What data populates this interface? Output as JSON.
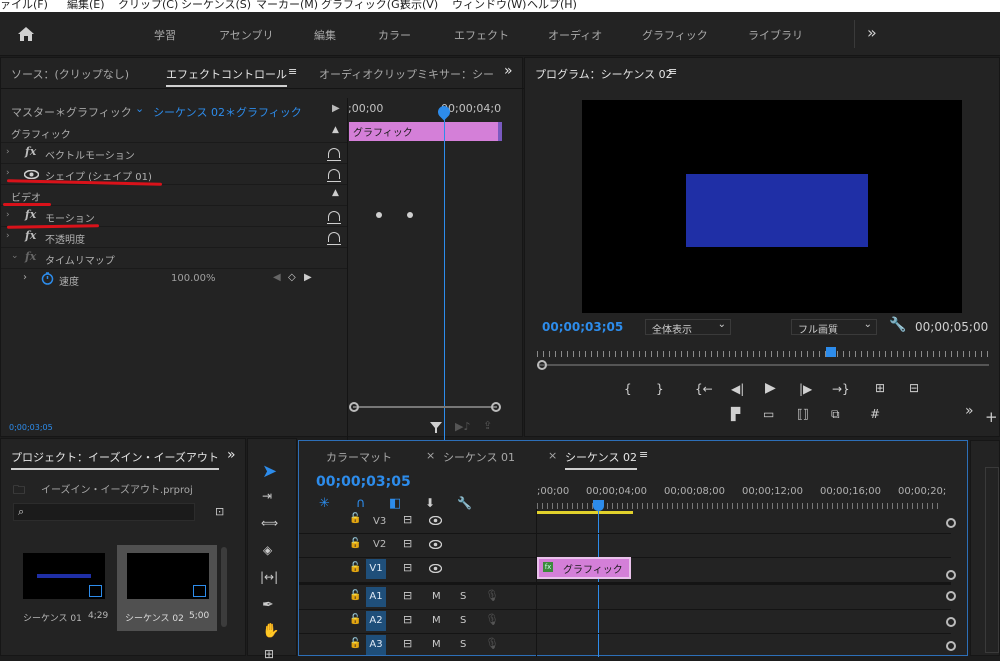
{
  "menu": {
    "items": [
      "ァイル(F)",
      "編集(E)",
      "クリップ(C)",
      "シーケンス(S)",
      "マーカー(M)",
      "グラフィック(G)",
      "表示(V)",
      "ウィンドウ(W)",
      "ヘルプ(H)"
    ]
  },
  "workspaces": {
    "items": [
      "学習",
      "アセンブリ",
      "編集",
      "カラー",
      "エフェクト",
      "オーディオ",
      "グラフィック",
      "ライブラリ"
    ],
    "more": "»"
  },
  "source_panel": {
    "tab_source": "ソース：(クリップなし)",
    "tab_effect_controls": "エフェクトコントロール",
    "tab_audio_mixer": "オーディオクリップミキサー：シー",
    "menu_icon": "≡",
    "more": "»",
    "master_label": "マスター＊グラフィック",
    "sequence_label": "シーケンス 02＊グラフィック",
    "timecode_start": ";00;00",
    "timecode_mid": "00;00;04;0",
    "clip_label": "グラフィック",
    "section_graphic": "グラフィック",
    "row_vector_motion": "ベクトルモーション",
    "row_shape": "シェイプ (シェイプ 01)",
    "section_video": "ビデオ",
    "row_motion": "モーション",
    "row_opacity": "不透明度",
    "row_time_remap": "タイムリマップ",
    "row_speed": "速度",
    "speed_value": "100.00%",
    "fx_label": "fx",
    "timecode_bottom": "0;00;03;05"
  },
  "program_monitor": {
    "title": "プログラム：シーケンス 02",
    "menu_icon": "≡",
    "current_time": "00;00;03;05",
    "zoom_select": "全体表示",
    "quality_select": "フル画質",
    "duration": "00;00;05;00",
    "frame_color": "#1f2fa6"
  },
  "project_panel": {
    "title": "プロジェクト：イーズイン・イーズアウト",
    "more": "»",
    "file_name": "イーズイン・イーズアウト.prproj",
    "items": [
      {
        "name": "シーケンス 01",
        "duration": "4;29"
      },
      {
        "name": "シーケンス 02",
        "duration": "5;00"
      }
    ]
  },
  "timeline": {
    "tabs": [
      "カラーマット",
      "シーケンス 01",
      "シーケンス 02"
    ],
    "menu_icon": "≡",
    "close_icon": "×",
    "current_time": "00;00;03;05",
    "ruler": [
      ";00;00",
      "00;00;04;00",
      "00;00;08;00",
      "00;00;12;00",
      "00;00;16;00",
      "00;00;20;"
    ],
    "video_tracks": [
      "V3",
      "V2",
      "V1"
    ],
    "audio_tracks": [
      "A1",
      "A2",
      "A3"
    ],
    "mute_label": "M",
    "solo_label": "S",
    "clip_label": "グラフィック",
    "clip_color": "#d47fd8"
  }
}
